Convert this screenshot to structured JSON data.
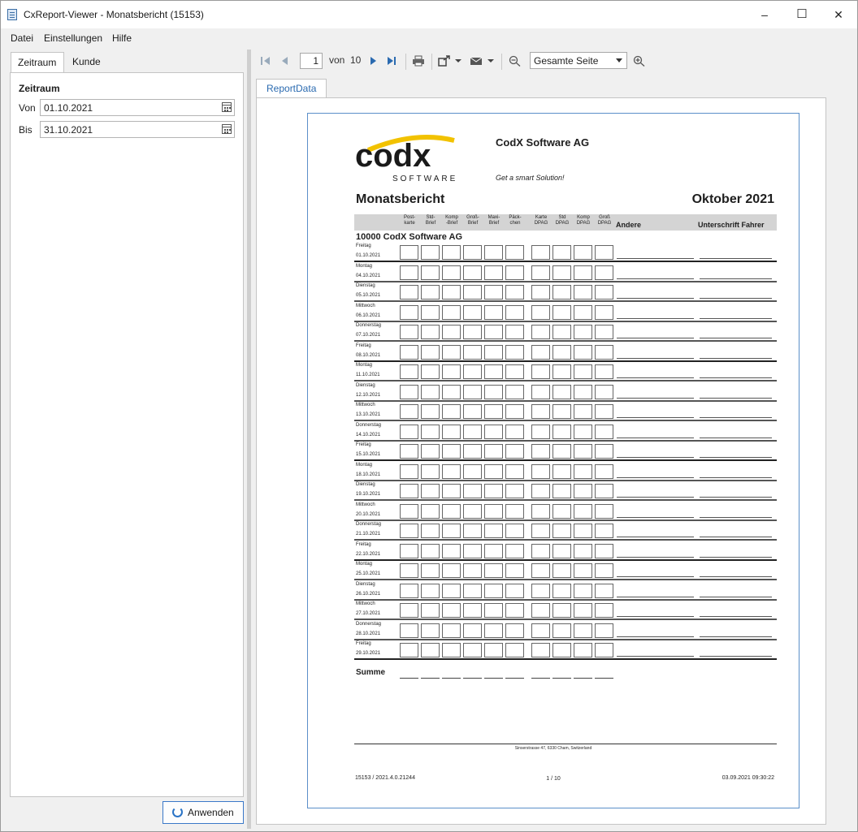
{
  "window": {
    "title": "CxReport-Viewer - Monatsbericht (15153)",
    "minimize": "–",
    "maximize": "☐",
    "close": "✕"
  },
  "menu": {
    "items": [
      "Datei",
      "Einstellungen",
      "Hilfe"
    ]
  },
  "left_panel": {
    "tabs": [
      "Zeitraum",
      "Kunde"
    ],
    "section_title": "Zeitraum",
    "from_label": "Von",
    "from_value": "01.10.2021",
    "to_label": "Bis",
    "to_value": "31.10.2021",
    "apply_label": "Anwenden"
  },
  "toolbar": {
    "page_current": "1",
    "page_of_label": "von",
    "page_total": "10",
    "zoom_value": "Gesamte Seite"
  },
  "report_tab": "ReportData",
  "report": {
    "company": "CodX Software AG",
    "slogan": "Get a smart Solution!",
    "logo_text": "codx",
    "logo_sub": "SOFTWARE",
    "title": "Monatsbericht",
    "month": "Oktober 2021",
    "columns": [
      "Post-\nkarte",
      "Std-\nBrief",
      "Komp\n-Brief",
      "Groß-\nBrief",
      "Maxi-\nBrief",
      "Päck-\nchen",
      "Karte\nDPAG",
      "Std\nDPAG",
      "Komp\nDPAG",
      "Groß\nDPAG"
    ],
    "col_andere": "Andere",
    "col_sign": "Unterschrift Fahrer",
    "customer": "10000 CodX Software AG",
    "rows": [
      {
        "day": "Freitag",
        "date": "01.10.2021"
      },
      {
        "day": "Montag",
        "date": "04.10.2021"
      },
      {
        "day": "Dienstag",
        "date": "05.10.2021"
      },
      {
        "day": "Mittwoch",
        "date": "06.10.2021"
      },
      {
        "day": "Donnerstag",
        "date": "07.10.2021"
      },
      {
        "day": "Freitag",
        "date": "08.10.2021"
      },
      {
        "day": "Montag",
        "date": "11.10.2021"
      },
      {
        "day": "Dienstag",
        "date": "12.10.2021"
      },
      {
        "day": "Mittwoch",
        "date": "13.10.2021"
      },
      {
        "day": "Donnerstag",
        "date": "14.10.2021"
      },
      {
        "day": "Freitag",
        "date": "15.10.2021"
      },
      {
        "day": "Montag",
        "date": "18.10.2021"
      },
      {
        "day": "Dienstag",
        "date": "19.10.2021"
      },
      {
        "day": "Mittwoch",
        "date": "20.10.2021"
      },
      {
        "day": "Donnerstag",
        "date": "21.10.2021"
      },
      {
        "day": "Freitag",
        "date": "22.10.2021"
      },
      {
        "day": "Montag",
        "date": "25.10.2021"
      },
      {
        "day": "Dienstag",
        "date": "26.10.2021"
      },
      {
        "day": "Mittwoch",
        "date": "27.10.2021"
      },
      {
        "day": "Donnerstag",
        "date": "28.10.2021"
      },
      {
        "day": "Freitag",
        "date": "29.10.2021"
      }
    ],
    "sum_label": "Summe",
    "address": "Sinserstrasse 47, 6330 Cham, Switzerland",
    "footer_left": "15153 / 2021.4.0.21244",
    "footer_mid": "1 / 10",
    "footer_right": "03.09.2021 09:30:22"
  },
  "colors": {
    "accent": "#2a6ab0",
    "logo_yellow": "#f2c200"
  }
}
